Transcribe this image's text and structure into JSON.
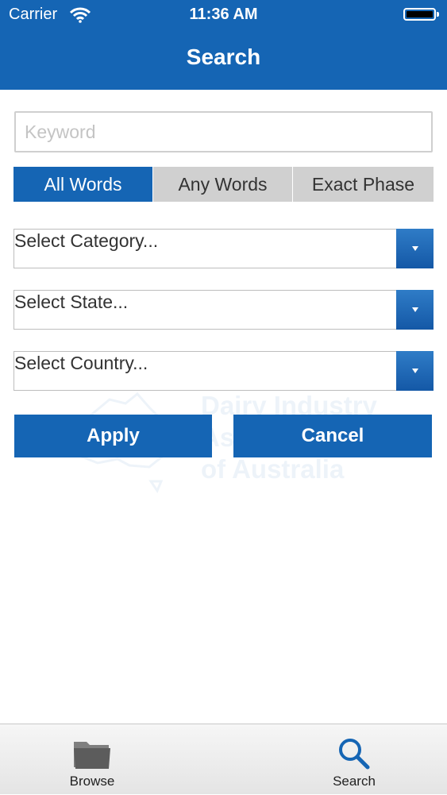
{
  "status_bar": {
    "carrier": "Carrier",
    "time": "11:36 AM",
    "wifi_icon": "wifi-icon",
    "battery_icon": "battery-icon"
  },
  "nav": {
    "title": "Search"
  },
  "search": {
    "keyword_placeholder": "Keyword",
    "keyword_value": "",
    "match_modes": [
      {
        "label": "All Words",
        "selected": true
      },
      {
        "label": "Any Words",
        "selected": false
      },
      {
        "label": "Exact Phase",
        "selected": false
      }
    ]
  },
  "filters": {
    "category": "Select Category...",
    "state": "Select State...",
    "country": "Select Country..."
  },
  "actions": {
    "apply": "Apply",
    "cancel": "Cancel"
  },
  "watermark": {
    "line1": "Dairy Industry",
    "line2": "As",
    "line3": "of Australia"
  },
  "tabbar": {
    "items": [
      {
        "label": "Browse",
        "icon": "folder-icon",
        "active": false
      },
      {
        "label": "Search",
        "icon": "search-icon",
        "active": true
      }
    ]
  },
  "colors": {
    "primary": "#1565b4",
    "segment_inactive": "#d0d0d0",
    "background": "#ffffff"
  }
}
